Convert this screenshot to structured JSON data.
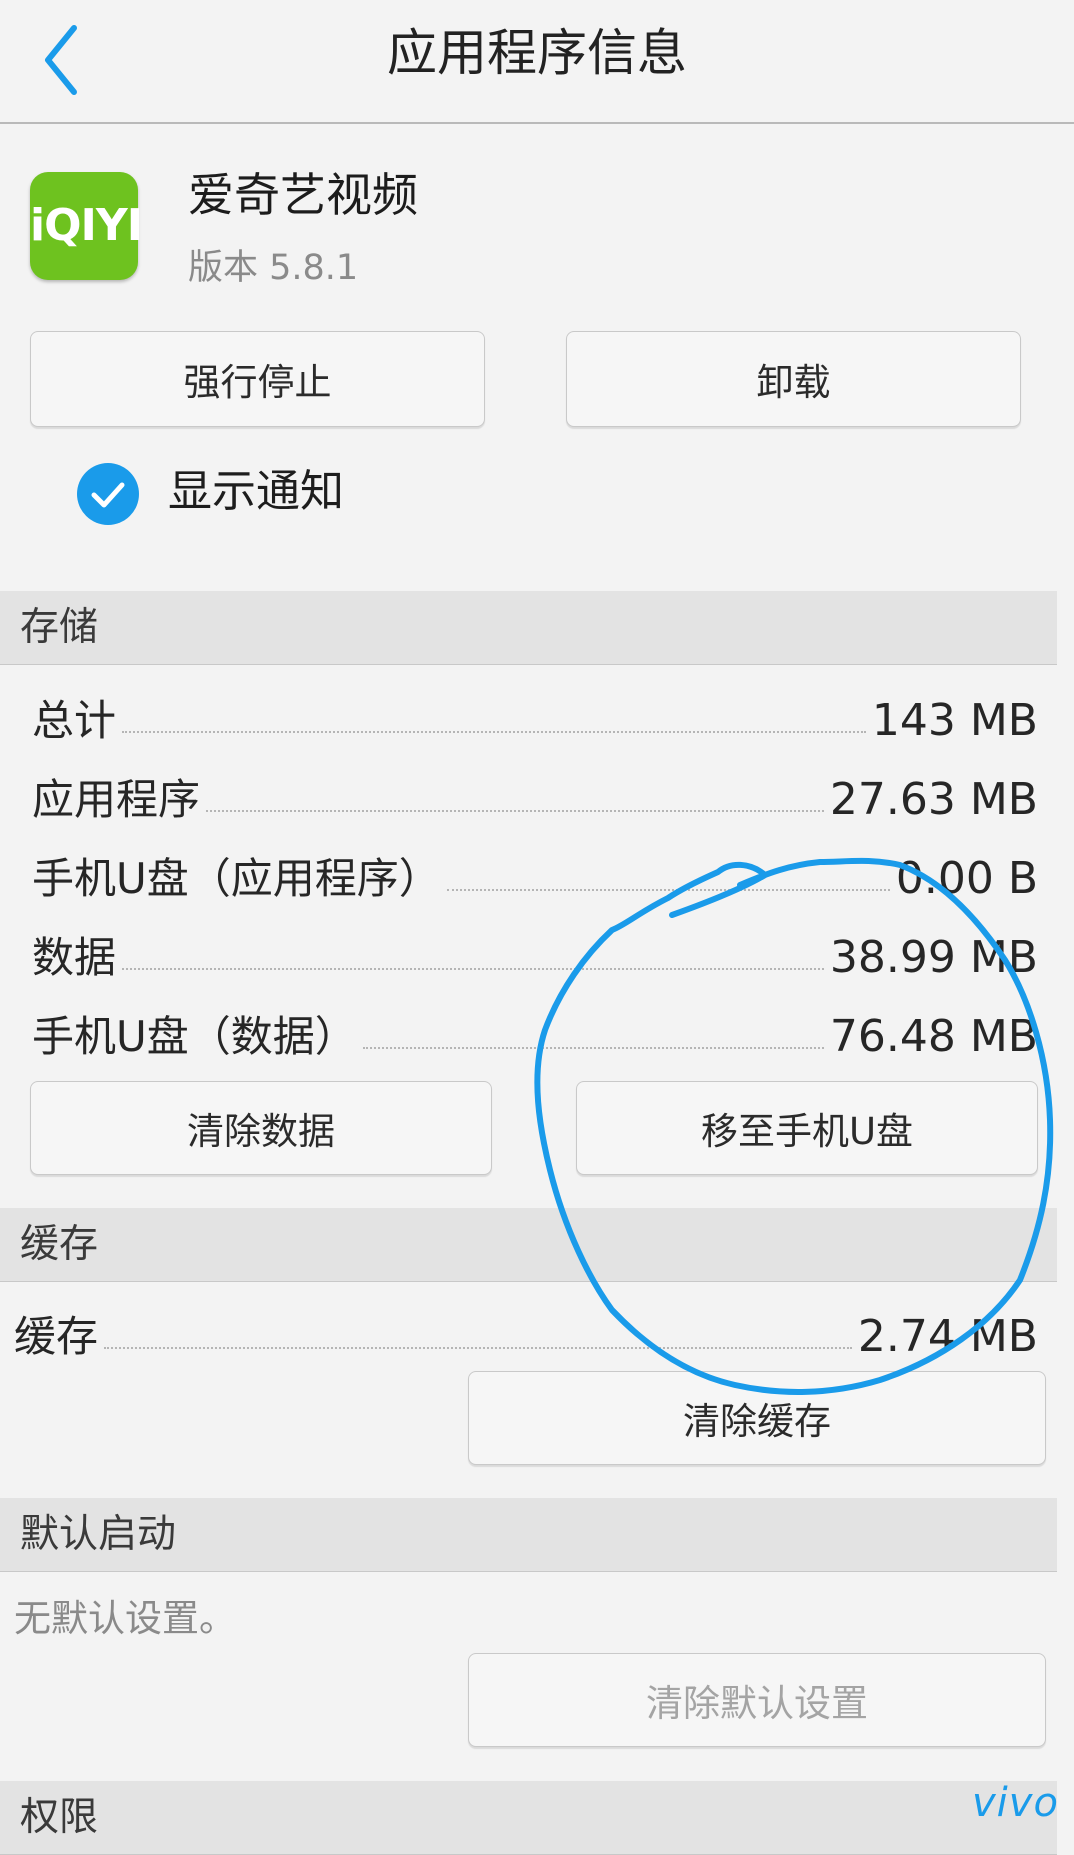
{
  "header": {
    "title": "应用程序信息"
  },
  "app": {
    "icon_text": "iQIYI",
    "name": "爱奇艺视频",
    "version": "版本 5.8.1"
  },
  "actions": {
    "force_stop": "强行停止",
    "uninstall": "卸载"
  },
  "notifications": {
    "label": "显示通知",
    "checked": true
  },
  "storage": {
    "title": "存储",
    "rows": [
      {
        "label": "总计",
        "value": "143 MB"
      },
      {
        "label": "应用程序",
        "value": "27.63 MB"
      },
      {
        "label": "手机U盘（应用程序）",
        "value": "0.00 B"
      },
      {
        "label": "数据",
        "value": "38.99 MB"
      },
      {
        "label": "手机U盘（数据）",
        "value": "76.48 MB"
      }
    ],
    "clear_data": "清除数据",
    "move_to_u": "移至手机U盘"
  },
  "cache": {
    "title": "缓存",
    "label": "缓存",
    "value": "2.74 MB",
    "clear_cache": "清除缓存"
  },
  "default_launch": {
    "title": "默认启动",
    "none_text": "无默认设置。",
    "clear_defaults": "清除默认设置"
  },
  "permissions": {
    "title": "权限"
  },
  "brand": {
    "logo": "vivo"
  },
  "colors": {
    "accent": "#1a9bea",
    "icon_green": "#6ec21f",
    "annotation": "#1a9bea"
  }
}
